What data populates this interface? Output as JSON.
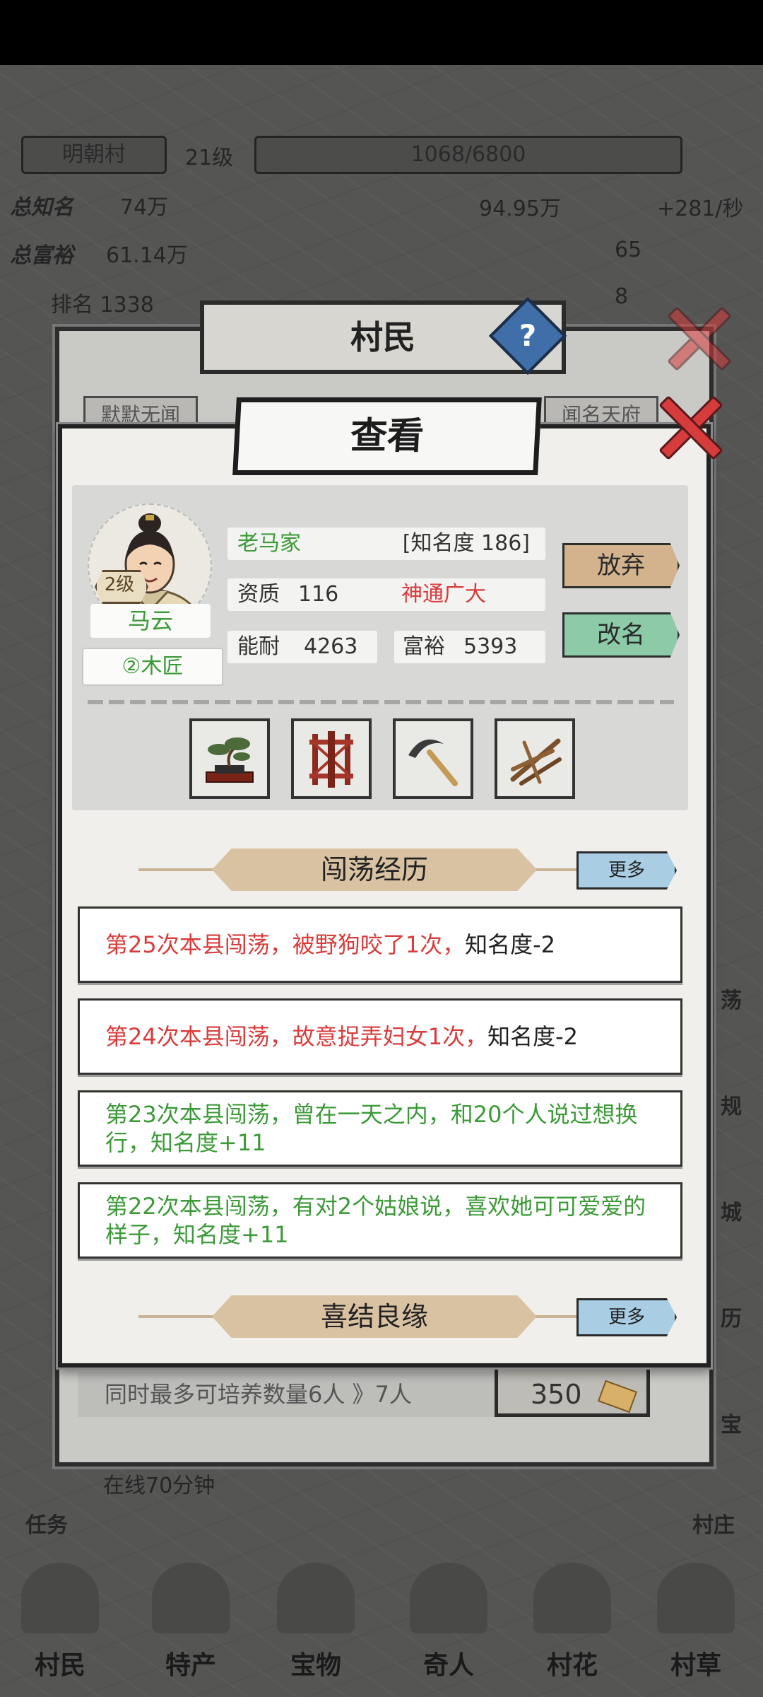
{
  "background": {
    "village_name": "明朝村",
    "village_level": "21级",
    "exp": "1068/6800",
    "stat_a_label": "总知名",
    "stat_a_value": "74万",
    "stat_b_label": "总富裕",
    "stat_b_value": "61.14万",
    "rank": "排名 1338",
    "coins": "94.95万",
    "coin_rate": "+281/秒",
    "gold": "65",
    "tickets": "8",
    "online_text": "在线70分钟",
    "task_label": "任务",
    "village_label": "村庄",
    "side_labels": [
      "荡",
      "规",
      "城",
      "历",
      "宝"
    ],
    "bottom_nav": [
      "村民",
      "特产",
      "宝物",
      "奇人",
      "村花",
      "村草"
    ]
  },
  "back_panel": {
    "title": "村民",
    "help": "?",
    "tab_left": "默默无闻",
    "tab_right": "闻名天府",
    "capacity_text": "同时最多可培养数量6人 》7人",
    "cost": "350"
  },
  "dialog": {
    "title": "查看",
    "villager": {
      "level": "2级",
      "name": "马云",
      "job": "②木匠",
      "family": "老马家",
      "fame": "[知名度 186]",
      "aptitude_label": "资质",
      "aptitude_value": "116",
      "trait": "神通广大",
      "ability_label": "能耐",
      "ability_value": "4263",
      "wealth_label": "富裕",
      "wealth_value": "5393"
    },
    "buttons": {
      "abandon": "放弃",
      "rename": "改名"
    },
    "items": [
      "bonsai-icon",
      "rack-icon",
      "sickle-icon",
      "sticks-icon"
    ],
    "experience": {
      "title": "闯荡经历",
      "more": "更多",
      "records": [
        {
          "text": "第25次本县闯荡，被野狗咬了1次，",
          "suffix": "知名度-2",
          "color": "#d93c3c"
        },
        {
          "text": "第24次本县闯荡，故意捉弄妇女1次，",
          "suffix": "知名度-2",
          "color": "#d93c3c"
        },
        {
          "text": "第23次本县闯荡，曾在一天之内，和20个人说过想换行，知名度+11",
          "suffix": "",
          "color": "#3c9a38"
        },
        {
          "text": "第22次本县闯荡，有对2个姑娘说，喜欢她可可爱爱的样子，知名度+11",
          "suffix": "",
          "color": "#3c9a38"
        }
      ]
    },
    "marriage": {
      "title": "喜结良缘",
      "more": "更多"
    }
  }
}
